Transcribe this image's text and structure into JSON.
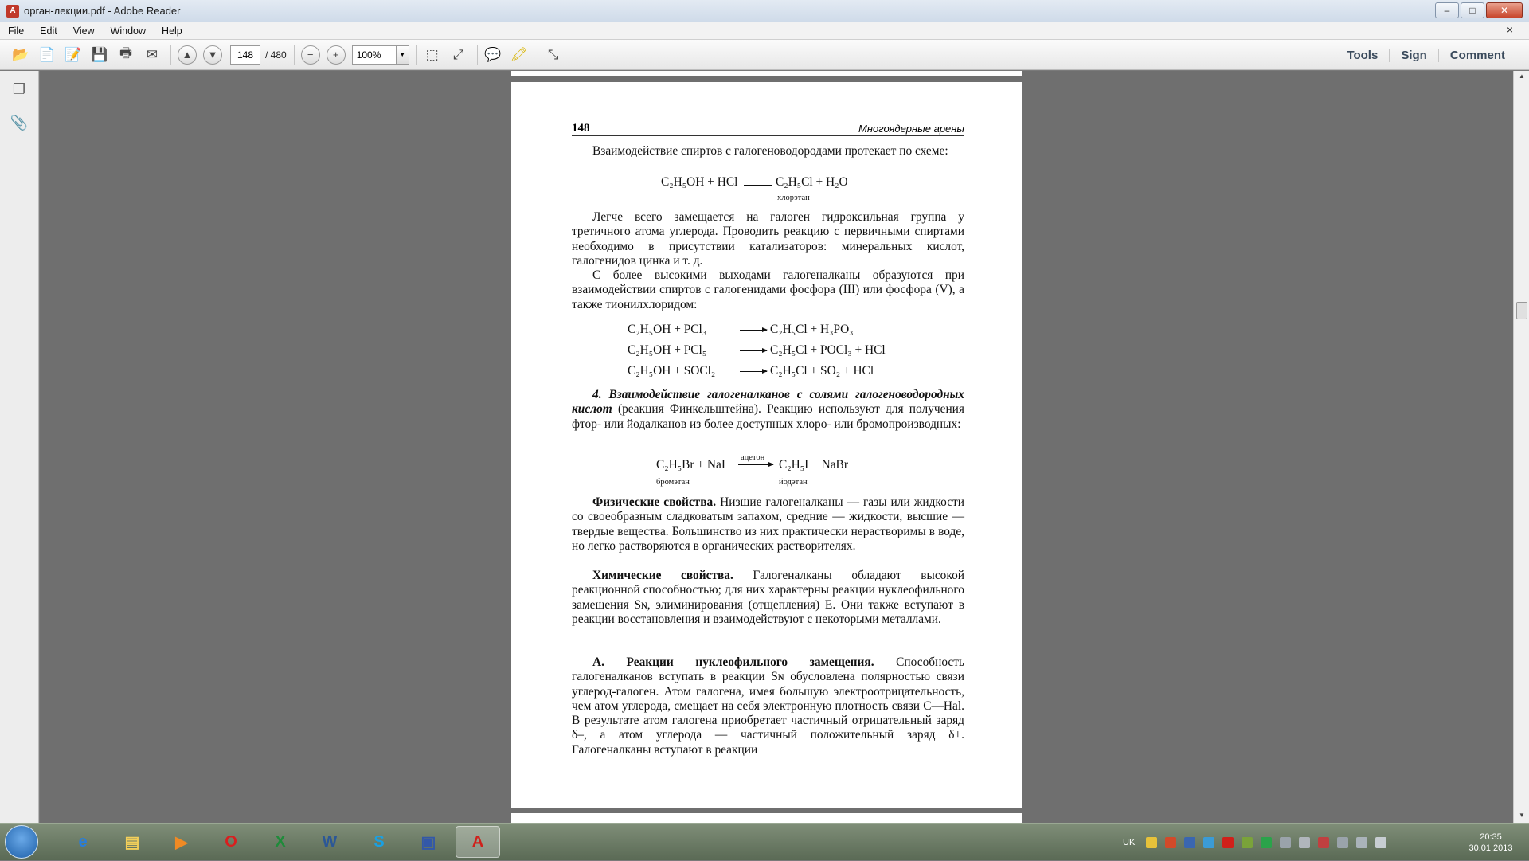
{
  "window": {
    "title": "орган-лекции.pdf - Adobe Reader",
    "minimize": "–",
    "maximize": "□",
    "close": "✕"
  },
  "menu": {
    "items": [
      "File",
      "Edit",
      "View",
      "Window",
      "Help"
    ],
    "close_doc": "×"
  },
  "toolbar": {
    "page_current": "148",
    "page_total": "/ 480",
    "zoom": "100%",
    "zoom_dropdown": "▼",
    "tools": "Tools",
    "sign": "Sign",
    "comment": "Comment"
  },
  "page": {
    "header_number": "148",
    "header_title": "Многоядерные арены",
    "p1": "Взаимодействие спиртов с галогеноводородами протекает по схеме:",
    "eq1_left": "C₂H₅OH + HCl",
    "eq1_right": "C₂H₅Cl + H₂O",
    "eq1_label": "хлорэтан",
    "p2": "Легче всего замещается на галоген гидроксильная группа у третичного атома углерода. Проводить реакцию с первичными спиртами необходимо в присутствии катализаторов: минеральных кислот, галогенидов цинка и т. д.",
    "p3": "С более высокими выходами галогеналканы образуются при взаимодействии спиртов с галогенидами фосфора (III) или фосфора (V), а также тионилхлоридом:",
    "eq2_left": "C₂H₅OH + PCl₃",
    "eq2_right": "C₂H₅Cl + H₃PO₃",
    "eq3_left": "C₂H₅OH + PCl₅",
    "eq3_right": "C₂H₅Cl + POCl₃ + HCl",
    "eq4_left": "C₂H₅OH + SOCl₂",
    "eq4_right": "C₂H₅Cl + SO₂ + HCl",
    "p4_bold": "4. Взаимодействие галогеналканов с солями галогеноводородных кислот",
    "p4_rest": " (реакция Финкельштейна). Реакцию используют для получения фтор- или йодалканов из более доступных хлоро- или бромопроизводных:",
    "eq5_left": "C₂H₅Br + NaI",
    "eq5_cond": "ацетон",
    "eq5_right": "C₂H₅I + NaBr",
    "eq5_label_left": "бромэтан",
    "eq5_label_right": "йодэтан",
    "p5_bold": "Физические свойства.",
    "p5_rest": " Низшие галогеналканы — газы или жидкости со своеобразным сладковатым запахом, средние — жидкости, высшие — твердые вещества. Большинство из них практически нерастворимы в воде, но легко растворяются в органических растворителях.",
    "p6_bold": "Химические свойства.",
    "p6_rest": " Галогеналканы обладают высокой реакционной способностью; для них характерны реакции нуклеофильного замещения Sɴ, элиминирования (отщепления) E. Они также вступают в реакции восстановления и взаимодействуют с некоторыми металлами.",
    "p7_bold": "А. Реакции нуклеофильного замещения.",
    "p7_rest": " Способность галогеналканов вступать в реакции Sɴ обусловлена полярностью связи углерод-галоген. Атом галогена, имея большую электроотрицательность, чем атом углерода, смещает на себя электронную плотность связи C—Hal. В результате атом галогена приобретает частичный отрицательный заряд δ–, а атом углерода — частичный положительный заряд δ+. Галогеналканы вступают в реакции"
  },
  "taskbar": {
    "lang": "UK",
    "time": "20:35",
    "date": "30.01.2013"
  },
  "colors": {
    "doc_bg": "#6f6f6f",
    "taskbar": "#6b7b65"
  }
}
